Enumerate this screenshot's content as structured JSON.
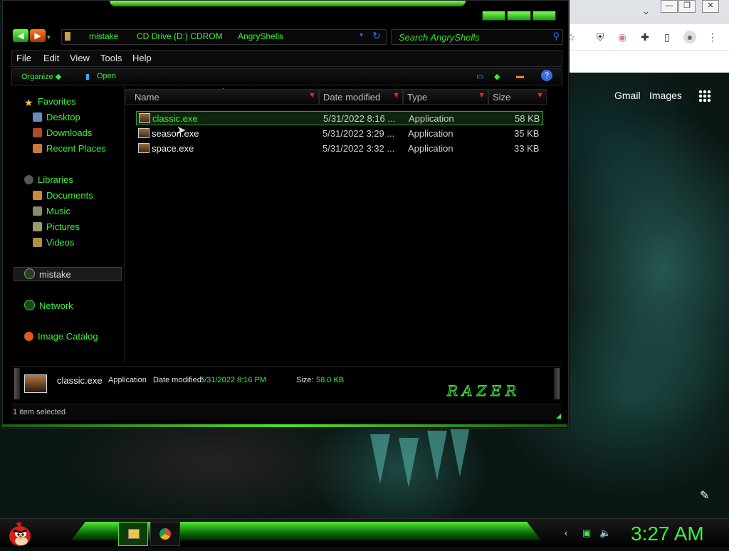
{
  "browser": {
    "minimize": "—",
    "restore": "❐",
    "close": "✕",
    "chevron": "⌄",
    "links": [
      "Gmail",
      "Images"
    ]
  },
  "explorer": {
    "breadcrumb": [
      "mistake",
      "CD Drive (D:) CDROM",
      "AngryShells"
    ],
    "search_placeholder": "Search AngryShells",
    "menu": [
      "File",
      "Edit",
      "View",
      "Tools",
      "Help"
    ],
    "commands": {
      "organize": "Organize",
      "open": "Open"
    },
    "sidebar": {
      "favorites": "Favorites",
      "favorites_items": [
        "Desktop",
        "Downloads",
        "Recent Places"
      ],
      "libraries": "Libraries",
      "libraries_items": [
        "Documents",
        "Music",
        "Pictures",
        "Videos"
      ],
      "homegroup": "mistake",
      "network": "Network",
      "image_catalog": "Image Catalog"
    },
    "columns": [
      "Name",
      "Date modified",
      "Type",
      "Size"
    ],
    "files": [
      {
        "name": "classic.exe",
        "date": "5/31/2022 8:16 ...",
        "type": "Application",
        "size": "58 KB"
      },
      {
        "name": "season.exe",
        "date": "5/31/2022 3:29 ...",
        "type": "Application",
        "size": "35 KB"
      },
      {
        "name": "space.exe",
        "date": "5/31/2022 3:32 ...",
        "type": "Application",
        "size": "33 KB"
      }
    ],
    "details": {
      "name": "classic.exe",
      "type": "Application",
      "date_label": "Date modified:",
      "date_value": "5/31/2022 8:16 PM",
      "size_label": "Size:",
      "size_value": "58.0 KB",
      "brand": "RAZER"
    },
    "status": "1 item selected"
  },
  "taskbar": {
    "clock": "3:27 AM"
  },
  "colors": {
    "accent": "#3cf03c",
    "background": "#000000"
  }
}
